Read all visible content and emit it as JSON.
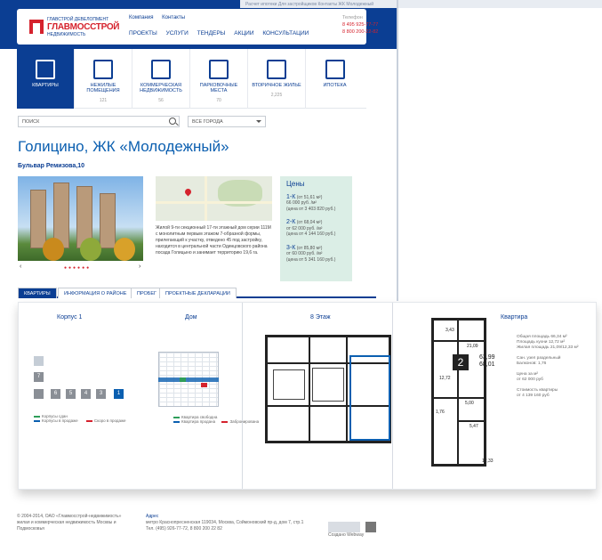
{
  "topstrip": "Расчет ипотеки   Для застройщиков   Контакты   ЖК Молодежный",
  "header": {
    "logo_small": "ГЛАВСТРОЙ ДЕВЕЛОПМЕНТ",
    "logo_main": "ГЛАВМОССТРОЙ",
    "logo_sub": "НЕДВИЖИМОСТЬ",
    "topnav": [
      "Компания",
      "Контакты"
    ],
    "mainnav": [
      "ПРОЕКТЫ",
      "УСЛУГИ",
      "ТЕНДЕРЫ",
      "АКЦИИ",
      "КОНСУЛЬТАЦИИ"
    ],
    "phone_label": "Телефон",
    "phone1": "8 495 925-77-77",
    "phone2": "8 800 200-22-82"
  },
  "categories": [
    {
      "label": "КВАРТИРЫ",
      "count": ""
    },
    {
      "label": "НЕЖИЛЫЕ ПОМЕЩЕНИЯ",
      "count": "121"
    },
    {
      "label": "КОММЕРЧЕСКАЯ НЕДВИЖИМОСТЬ",
      "count": "56"
    },
    {
      "label": "ПАРКОВОЧНЫЕ МЕСТА",
      "count": "70"
    },
    {
      "label": "ВТОРИЧНОЕ ЖИЛЬЕ",
      "count": "2,225"
    },
    {
      "label": "ИПОТЕКА",
      "count": ""
    }
  ],
  "search": {
    "placeholder": "ПОИСК",
    "select": "ВСЕ ГОРОДА"
  },
  "page": {
    "title": "Голицино, ЖК «Молодежный»",
    "address": "Бульвар Ремизова,10"
  },
  "description": "Жилой 9-ти секционный 17-ти этажный дом серии 111М с монолитным первым этажом 7-образной формы, прилегающий к участку, отведено 45 под застройку, находится в центральной части Одинцовского района посада Голицыно и занимает территорию 19,6 га.",
  "prices": {
    "heading": "Цены",
    "rows": [
      {
        "k": "1-К",
        "area": "(от 51,61 м²)",
        "per": "66 000 руб. /м²",
        "total": "(цена от 3 403 820 руб.)"
      },
      {
        "k": "2-К",
        "area": "(от 68,04 м²)",
        "per": "от 62 000 руб. /м²",
        "total": "(цена от 4 144 160 руб.)"
      },
      {
        "k": "3-К",
        "area": "(от 85,80 м²)",
        "per": "от 60 000 руб. /м²",
        "total": "(цена от 5 341 160 руб.)"
      }
    ]
  },
  "tabs": [
    "КВАРТИРЫ",
    "ИНФОРМАЦИЯ О РАЙОНЕ",
    "ПРОБЕГ",
    "ПРОЕКТНЫЕ ДЕКЛАРАЦИИ"
  ],
  "panel": {
    "korpus": "Корпус 1",
    "dom": "Дом",
    "floor": "8 Этаж",
    "kvartira": "Квартира",
    "buildings": [
      "7",
      "6",
      "5",
      "4",
      "3",
      "1"
    ],
    "korpus_legend": [
      "Корпусы сдан",
      "Корпусы в продаже",
      "Скоро в продаже"
    ],
    "dom_legend": [
      "Квартира свободна",
      "Квартира продана",
      "Забронирована"
    ],
    "rooms": "2",
    "area_total": "63,99",
    "area_living": "68,01",
    "plan_labels": [
      "3,43",
      "21,09",
      "12,72",
      "5,00",
      "1,76",
      "5,47",
      "12,33"
    ],
    "info": [
      "Общая площадь 66,34 м²",
      "Площадь кухни 12,72 м²",
      "Жилая площадь 21,09/12,33 м²",
      "",
      "Сан. узел раздельный",
      "Балконов: 1,76",
      "",
      "Цена за м²",
      "от 62 000 руб",
      "",
      "Стоимость квартиры",
      "от 4 139 160 руб"
    ]
  },
  "footer": {
    "copy": "© 2004-2014, ОАО «Главмосстрой-недвижимость» жилая и коммерческая недвижимость Москвы и Подмосковья",
    "addr_h": "Адрес",
    "addr": "метро Краснопресненская 119034, Москва, Соймоновский пр-д, дом 7, стр.1 Тел. (495) 926-77-72, 8 800 200 22 82",
    "made": "Создано Webway"
  }
}
